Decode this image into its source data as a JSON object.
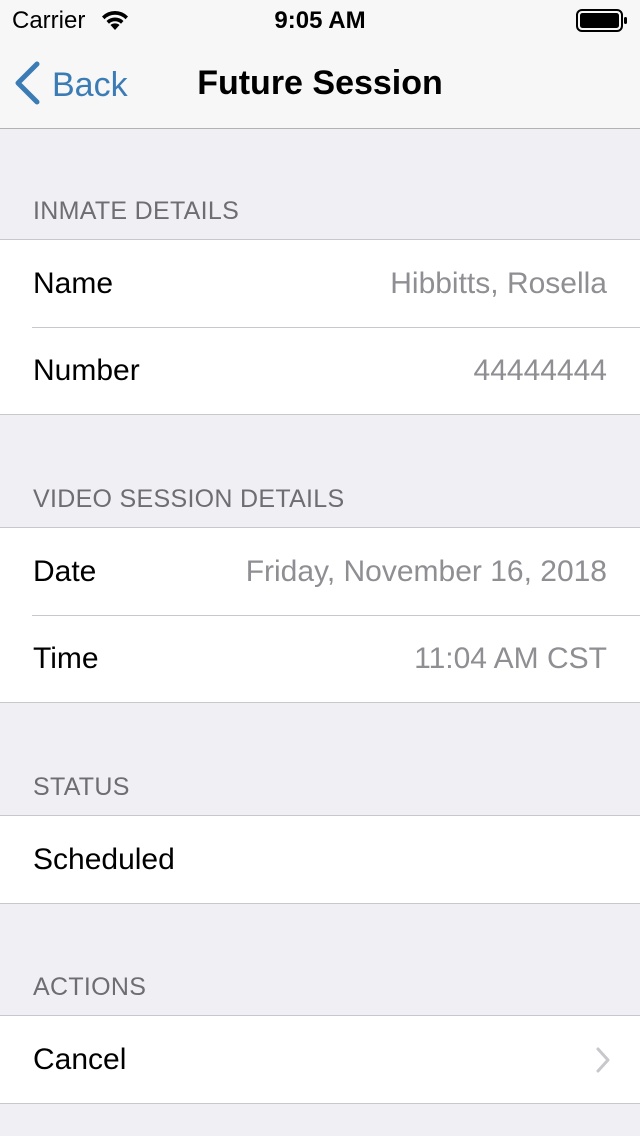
{
  "status_bar": {
    "carrier": "Carrier",
    "time": "9:05 AM",
    "wifi_icon": "wifi-icon",
    "battery_icon": "battery-full-icon"
  },
  "nav": {
    "back_label": "Back",
    "back_icon": "chevron-left-icon",
    "title": "Future Session",
    "accent_color": "#3b7cb5"
  },
  "inmate_details": {
    "header": "INMATE DETAILS",
    "rows": [
      {
        "label": "Name",
        "value": "Hibbitts, Rosella"
      },
      {
        "label": "Number",
        "value": "44444444"
      }
    ]
  },
  "video_session_details": {
    "header": "VIDEO SESSION DETAILS",
    "rows": [
      {
        "label": "Date",
        "value": "Friday, November 16, 2018"
      },
      {
        "label": "Time",
        "value": "11:04 AM CST"
      }
    ]
  },
  "status": {
    "header": "STATUS",
    "value": "Scheduled"
  },
  "actions": {
    "header": "ACTIONS",
    "cancel_label": "Cancel",
    "cancel_icon": "chevron-right-icon"
  }
}
